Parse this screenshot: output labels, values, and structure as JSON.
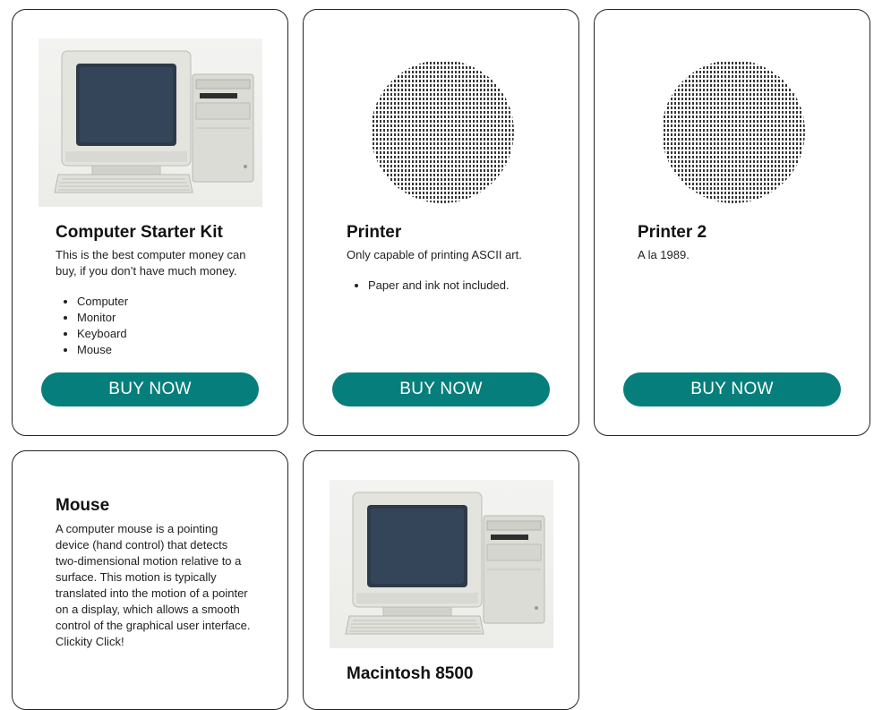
{
  "products": [
    {
      "title": "Computer Starter Kit",
      "description": "This is the best computer money can buy, if you don’t have much money.",
      "features": [
        "Computer",
        "Monitor",
        "Keyboard",
        "Mouse"
      ],
      "button": "BUY NOW",
      "image": "computer-photo"
    },
    {
      "title": "Printer",
      "description": "Only capable of printing ASCII art.",
      "features": [
        "Paper and ink not included."
      ],
      "button": "BUY NOW",
      "image": "ascii-art"
    },
    {
      "title": "Printer 2",
      "description": "A la 1989.",
      "features": [],
      "button": "BUY NOW",
      "image": "ascii-art"
    },
    {
      "title": "Mouse",
      "description": "A computer mouse is a pointing device (hand control) that detects two-dimensional motion relative to a surface. This motion is typically translated into the motion of a pointer on a display, which allows a smooth control of the graphical user interface. Clickity Click!",
      "features": [],
      "image": "none"
    },
    {
      "title": "Macintosh 8500",
      "image": "computer-photo"
    }
  ],
  "colors": {
    "button": "#067f7c",
    "border": "#222222"
  }
}
